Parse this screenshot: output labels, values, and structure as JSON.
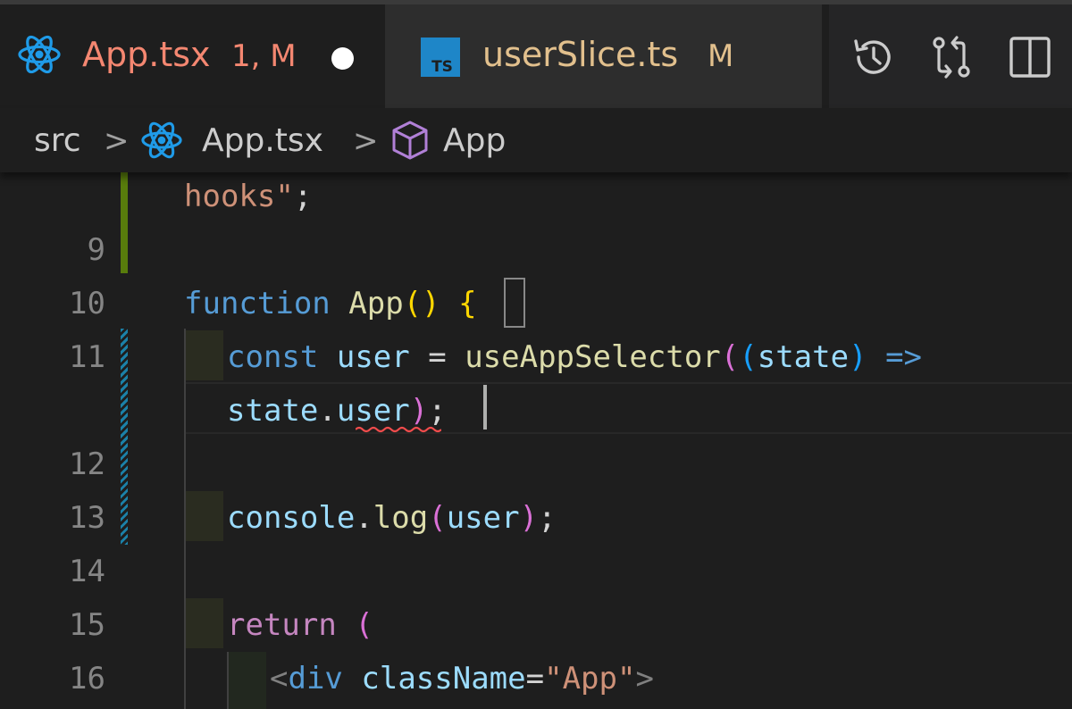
{
  "tabs": [
    {
      "title": "App.tsx",
      "status": "1, M",
      "active": true,
      "dirty": true,
      "icon": "react-icon"
    },
    {
      "title": "userSlice.ts",
      "status": "M",
      "active": false,
      "dirty": false,
      "icon": "typescript-file-icon",
      "icon_text": "TS"
    }
  ],
  "actions": [
    {
      "name": "open-timeline-button",
      "icon": "history-icon"
    },
    {
      "name": "open-changes-button",
      "icon": "git-compare-icon"
    },
    {
      "name": "split-editor-button",
      "icon": "split-editor-icon"
    }
  ],
  "breadcrumb": {
    "folder": "src",
    "file": "App.tsx",
    "symbol": "App",
    "separator": ">"
  },
  "editor": {
    "line_numbers": [
      "",
      "9",
      "10",
      "11",
      "",
      "12",
      "13",
      "14",
      "15",
      "16"
    ],
    "lines": {
      "l0": {
        "s1": "hooks\"",
        "s2": ";"
      },
      "l2": {
        "kw": "function",
        "fn": "App",
        "p1": "(",
        "p2": ")",
        "brace": "{"
      },
      "l3": {
        "kw": "const",
        "var": "user",
        "eq": "=",
        "fn": "useAppSelector",
        "p1": "(",
        "p2": "(",
        "arg": "state",
        "p3": ")",
        "arrow": "=>"
      },
      "l4": {
        "obj": "state",
        "dot": ".",
        "prop": "user",
        "p1": ")",
        "semi": ";"
      },
      "l6": {
        "obj": "console",
        "dot": ".",
        "fn": "log",
        "p1": "(",
        "arg": "user",
        "p2": ")",
        "semi": ";"
      },
      "l8": {
        "kw": "return",
        "p1": "("
      },
      "l9": {
        "lt": "<",
        "tag": "div",
        "attr": "className",
        "eq": "=",
        "val": "\"App\"",
        "gt": ">"
      }
    }
  },
  "colors": {
    "editor_bg": "#1e1e1e",
    "active_tab_title": "#f48771",
    "inactive_tab_title": "#e2c08d",
    "diff_added": "#587c0c",
    "diff_modified": "#1b81a8",
    "error_squiggle": "#f14c4c",
    "react_blue": "#1f9be8",
    "symbol_purple": "#b180d7"
  }
}
